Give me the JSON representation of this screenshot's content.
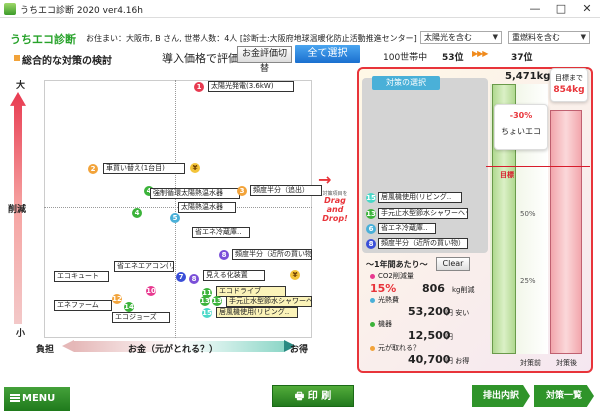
{
  "window": {
    "title": "うちエコ診断 2020 ver4.16h",
    "controls": [
      "—",
      "□",
      "✕"
    ]
  },
  "header": {
    "brand": "うちエコ診断",
    "address": "お住まい：大阪市, B さん, 世帯人数：4人 [診断士:大阪府地球温暖化防止活動推進センター]",
    "filter1": "太陽光を含む",
    "filter2": "重燃料を含む"
  },
  "toolbar": {
    "section_title": "総合的な対策の検討",
    "price_label": "導入価格で評価",
    "switch_button": "お金評価切替",
    "select_all_button": "全て選択",
    "rank1_label": "100世帯中",
    "rank1_value": "53位",
    "rank_arrows": "▶▶▶",
    "rank2_value": "37位"
  },
  "chart_axes": {
    "y_top": "大",
    "y_mid": "削減",
    "y_bottom": "小",
    "x_left": "負担",
    "x_center": "お金（元がとれる？）",
    "x_right": "お得"
  },
  "chart_items": [
    {
      "n": "1",
      "label": "太陽光発電(3.6kW)",
      "color": "#e83a50"
    },
    {
      "n": "2",
      "label": "車買い替え(1台目)",
      "color": "#f2a33a"
    },
    {
      "n": "3",
      "label": "頻度半分（追出）",
      "color": "#f2a33a"
    },
    {
      "n": "4",
      "label": "強制循環太陽熱温水器",
      "color": "#3bb33a"
    },
    {
      "n": "5",
      "label": "太陽熱温水器",
      "color": "#4ab0d8"
    },
    {
      "n": "6",
      "label": "省エネ冷蔵庫..",
      "color": "#4ab0d8"
    },
    {
      "n": "7",
      "label": "見える化装置",
      "color": "#3a4fd8"
    },
    {
      "n": "8",
      "label": "頻度半分（近所の買い物）",
      "color": "#7a4fd8"
    },
    {
      "n": "9",
      "label": "省エネエアコン(リビ..",
      "color": "#3bb33a"
    },
    {
      "n": "10",
      "label": "エコキュート",
      "color": "#e83a90"
    },
    {
      "n": "11",
      "label": "エコドライブ",
      "color": "#3bb33a"
    },
    {
      "n": "12",
      "label": "エネファーム",
      "color": "#f2a33a"
    },
    {
      "n": "13",
      "label": "手元止水型節水シャワーヘッド",
      "color": "#3bb33a"
    },
    {
      "n": "14",
      "label": "エコジョーズ",
      "color": "#3bb33a"
    },
    {
      "n": "15",
      "label": "居風機使用(リビング..",
      "color": "#4ad8c8"
    }
  ],
  "drag_hint": {
    "small": "対策項目を",
    "big": "Drag and Drop!"
  },
  "selection_panel": {
    "header": "対策の選択",
    "items": [
      {
        "n": "15",
        "label": "居風機使用(リビング..",
        "color": "#4ad8c8"
      },
      {
        "n": "13",
        "label": "手元止水型節水シャワーヘッド",
        "color": "#3bb33a"
      },
      {
        "n": "6",
        "label": "省エネ冷蔵庫..",
        "color": "#4ab0d8"
      },
      {
        "n": "8",
        "label": "頻度半分（近所の買い物）",
        "color": "#7a4fd8"
      }
    ]
  },
  "metrics": {
    "per_year": "～1年間あたり～",
    "clear_button": "Clear",
    "co2_label": "CO2削減量",
    "co2_pct": "15%",
    "co2_value": "806",
    "co2_unit": "kg削減",
    "heat_label": "光熱費",
    "heat_value": "53,200",
    "heat_unit": "円 安い",
    "maint_label": "機器",
    "maint_value": "12,500",
    "maint_unit": "円",
    "payback_label": "元が取れる？",
    "payback_value": "40,700",
    "payback_unit": "円 お得"
  },
  "bars": {
    "total": "5,471kg",
    "reduction": "-30%",
    "comment": "ちょいエコ",
    "target_label": "目標",
    "target_until": "目標まで",
    "target_value": "854kg",
    "pct50": "50%",
    "pct25": "25%",
    "before_label": "対策前",
    "after_label": "対策後"
  },
  "footer": {
    "menu_button": "MENU",
    "print_button": "印 刷",
    "output_button": "排出内訳",
    "measures_button": "対策一覧"
  }
}
